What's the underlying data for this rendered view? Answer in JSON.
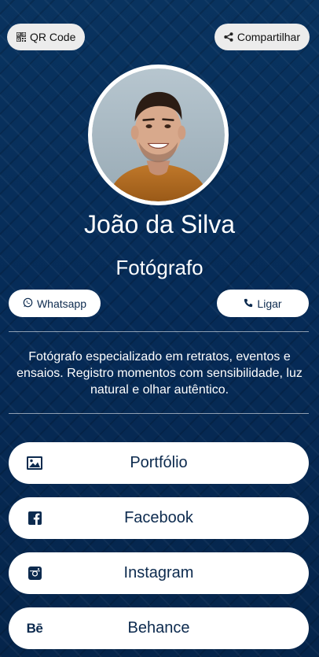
{
  "header": {
    "qr_label": "QR Code",
    "share_label": "Compartilhar",
    "qr_icon": "qr-code-icon",
    "share_icon": "share-icon"
  },
  "profile": {
    "name": "João da Silva",
    "role": "Fotógrafo",
    "bio": "Fotógrafo especializado em retratos, eventos e ensaios. Registro momentos com sensibilidade, luz natural e olhar autêntico."
  },
  "actions": {
    "whatsapp_label": "Whatsapp",
    "call_label": "Ligar",
    "whatsapp_icon": "whatsapp-icon",
    "call_icon": "phone-icon"
  },
  "links": [
    {
      "label": "Portfólio",
      "icon": "image-icon"
    },
    {
      "label": "Facebook",
      "icon": "facebook-icon"
    },
    {
      "label": "Instagram",
      "icon": "instagram-icon"
    },
    {
      "label": "Behance",
      "icon": "behance-icon",
      "icon_text": "Bē"
    }
  ],
  "colors": {
    "background": "#062a55",
    "button_bg": "#ffffff",
    "button_text": "#0c2a4e",
    "top_button_bg": "#ececec"
  }
}
